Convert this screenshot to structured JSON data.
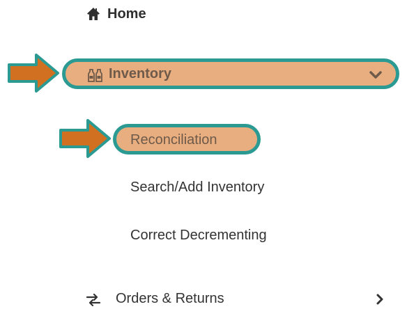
{
  "nav": {
    "home": {
      "label": "Home",
      "icon": "home-icon"
    },
    "inventory": {
      "label": "Inventory",
      "icon": "bottles-icon",
      "expanded": true,
      "chevron": "chevron-down-icon"
    },
    "inventory_subitems": [
      {
        "label": "Reconciliation",
        "highlighted": true
      },
      {
        "label": "Search/Add Inventory"
      },
      {
        "label": "Correct Decrementing"
      }
    ],
    "orders": {
      "label": "Orders & Returns",
      "icon": "exchange-icon",
      "chevron": "chevron-right-icon"
    }
  },
  "annotations": {
    "arrow_color": "#d07020",
    "arrow_outline": "#2a9a92",
    "highlight_fill": "#e8ae80",
    "highlight_outline": "#2a9a92"
  }
}
